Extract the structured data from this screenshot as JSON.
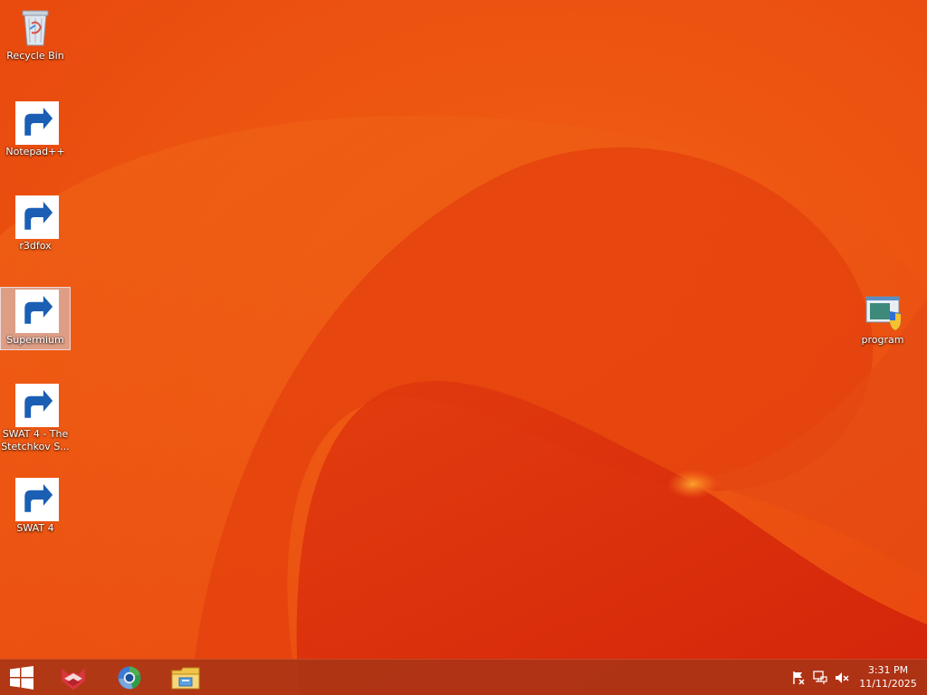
{
  "desktop": {
    "icons": [
      {
        "label": "Recycle Bin",
        "icon": "recycle-bin-icon",
        "shortcut": false,
        "selected": false
      },
      {
        "label": "Notepad++",
        "icon": "notepad-plus-plus-icon",
        "shortcut": true,
        "selected": false
      },
      {
        "label": "r3dfox",
        "icon": "r3dfox-icon",
        "shortcut": true,
        "selected": false
      },
      {
        "label": "Supermium",
        "icon": "supermium-icon",
        "shortcut": true,
        "selected": true
      },
      {
        "label": "SWAT 4 - The Stetchkov S...",
        "icon": "swat4-icon",
        "shortcut": true,
        "selected": false
      },
      {
        "label": "SWAT 4",
        "icon": "swat4-icon",
        "shortcut": true,
        "selected": false
      },
      {
        "label": "program",
        "icon": "program-installer-icon",
        "shortcut": false,
        "selected": false
      }
    ]
  },
  "taskbar": {
    "start_icon": "windows-start-icon",
    "pinned": [
      {
        "icon": "r3dfox-icon"
      },
      {
        "icon": "supermium-icon"
      },
      {
        "icon": "file-explorer-icon"
      }
    ],
    "tray": [
      {
        "icon": "action-center-flag-icon"
      },
      {
        "icon": "network-icon"
      },
      {
        "icon": "volume-muted-icon"
      }
    ],
    "clock": {
      "time": "3:31 PM",
      "date": "11/11/2025"
    }
  },
  "colors": {
    "wallpaper_base": "#ea4e10",
    "wallpaper_dark": "#d92a0c",
    "taskbar": "#a83416"
  }
}
